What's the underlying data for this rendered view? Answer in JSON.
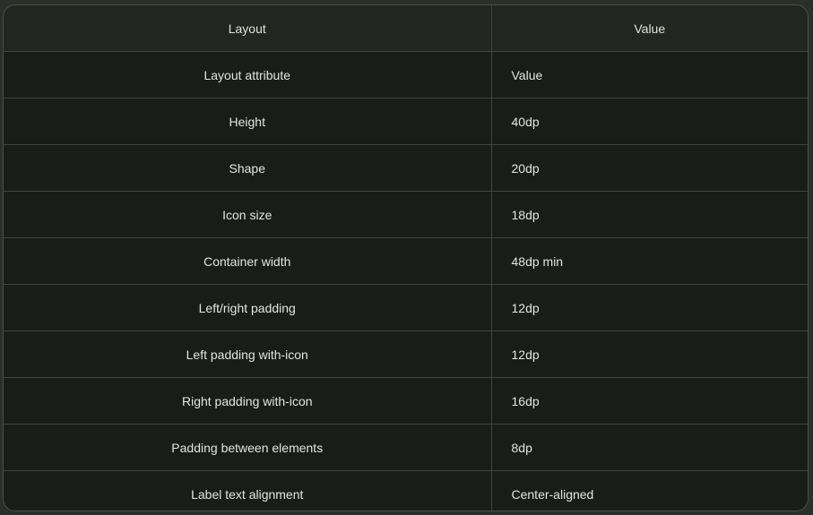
{
  "table": {
    "headers": [
      "Layout",
      "Value"
    ],
    "rows": [
      [
        "Layout attribute",
        "Value"
      ],
      [
        "Height",
        "40dp"
      ],
      [
        "Shape",
        "20dp"
      ],
      [
        "Icon size",
        "18dp"
      ],
      [
        "Container width",
        "48dp min"
      ],
      [
        "Left/right padding",
        "12dp"
      ],
      [
        "Left padding with-icon",
        "12dp"
      ],
      [
        "Right padding with-icon",
        "16dp"
      ],
      [
        "Padding between elements",
        "8dp"
      ],
      [
        "Label text alignment",
        "Center-aligned"
      ]
    ]
  }
}
